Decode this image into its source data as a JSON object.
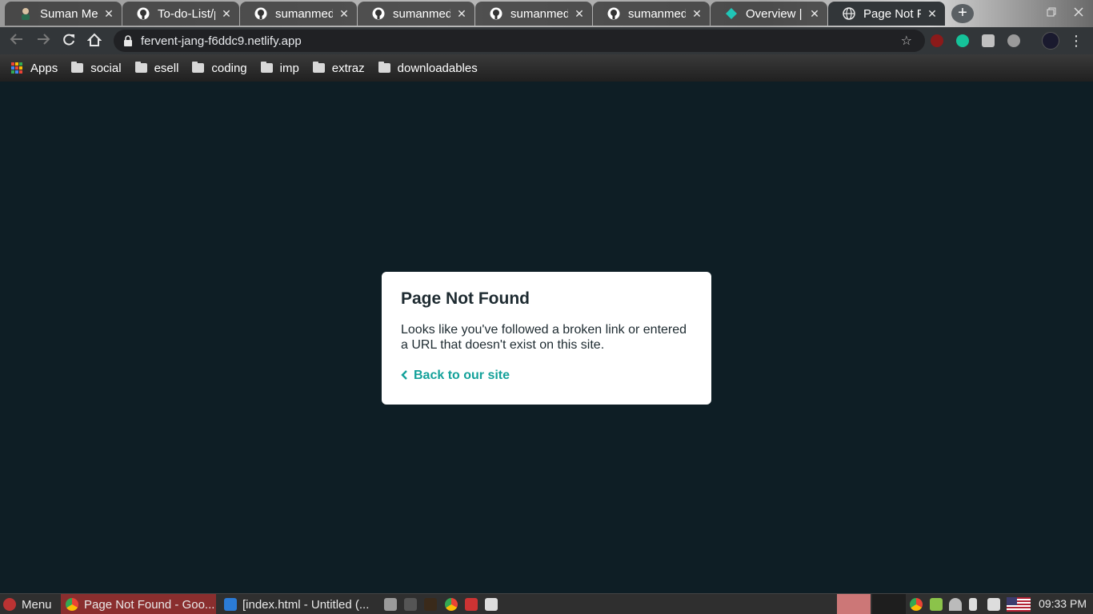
{
  "browser": {
    "tabs": [
      {
        "title": "Suman Med",
        "icon": "person-avatar-icon",
        "active": false
      },
      {
        "title": "To-do-List/p",
        "icon": "github-icon",
        "active": false
      },
      {
        "title": "sumanmedc",
        "icon": "github-icon",
        "active": false
      },
      {
        "title": "sumanmedc",
        "icon": "github-icon",
        "active": false
      },
      {
        "title": "sumanmedc",
        "icon": "github-icon",
        "active": false
      },
      {
        "title": "sumanmedc",
        "icon": "github-icon",
        "active": false
      },
      {
        "title": "Overview | N",
        "icon": "netlify-icon",
        "active": false
      },
      {
        "title": "Page Not Fo",
        "icon": "globe-icon",
        "active": true
      }
    ],
    "tab_close_glyph": "✕",
    "new_tab_glyph": "+",
    "address_url": "fervent-jang-f6ddc9.netlify.app",
    "bookmarks": [
      {
        "label": "Apps",
        "icon": "apps-grid-icon"
      },
      {
        "label": "social",
        "icon": "folder-icon"
      },
      {
        "label": "esell",
        "icon": "folder-icon"
      },
      {
        "label": "coding",
        "icon": "folder-icon"
      },
      {
        "label": "imp",
        "icon": "folder-icon"
      },
      {
        "label": "extraz",
        "icon": "folder-icon"
      },
      {
        "label": "downloadables",
        "icon": "folder-icon"
      }
    ]
  },
  "page": {
    "title": "Page Not Found",
    "message": "Looks like you've followed a broken link or entered a URL that doesn't exist on this site.",
    "back_link": "Back to our site",
    "accent_color": "#14a19a",
    "background_color": "#0e1e25"
  },
  "taskbar": {
    "menu_label": "Menu",
    "windows": [
      {
        "label": "Page Not Found - Goo...",
        "icon": "chrome-icon",
        "active": true
      },
      {
        "label": "[index.html - Untitled (...",
        "icon": "vscode-icon",
        "active": false
      }
    ],
    "clock": "09:33 PM"
  }
}
